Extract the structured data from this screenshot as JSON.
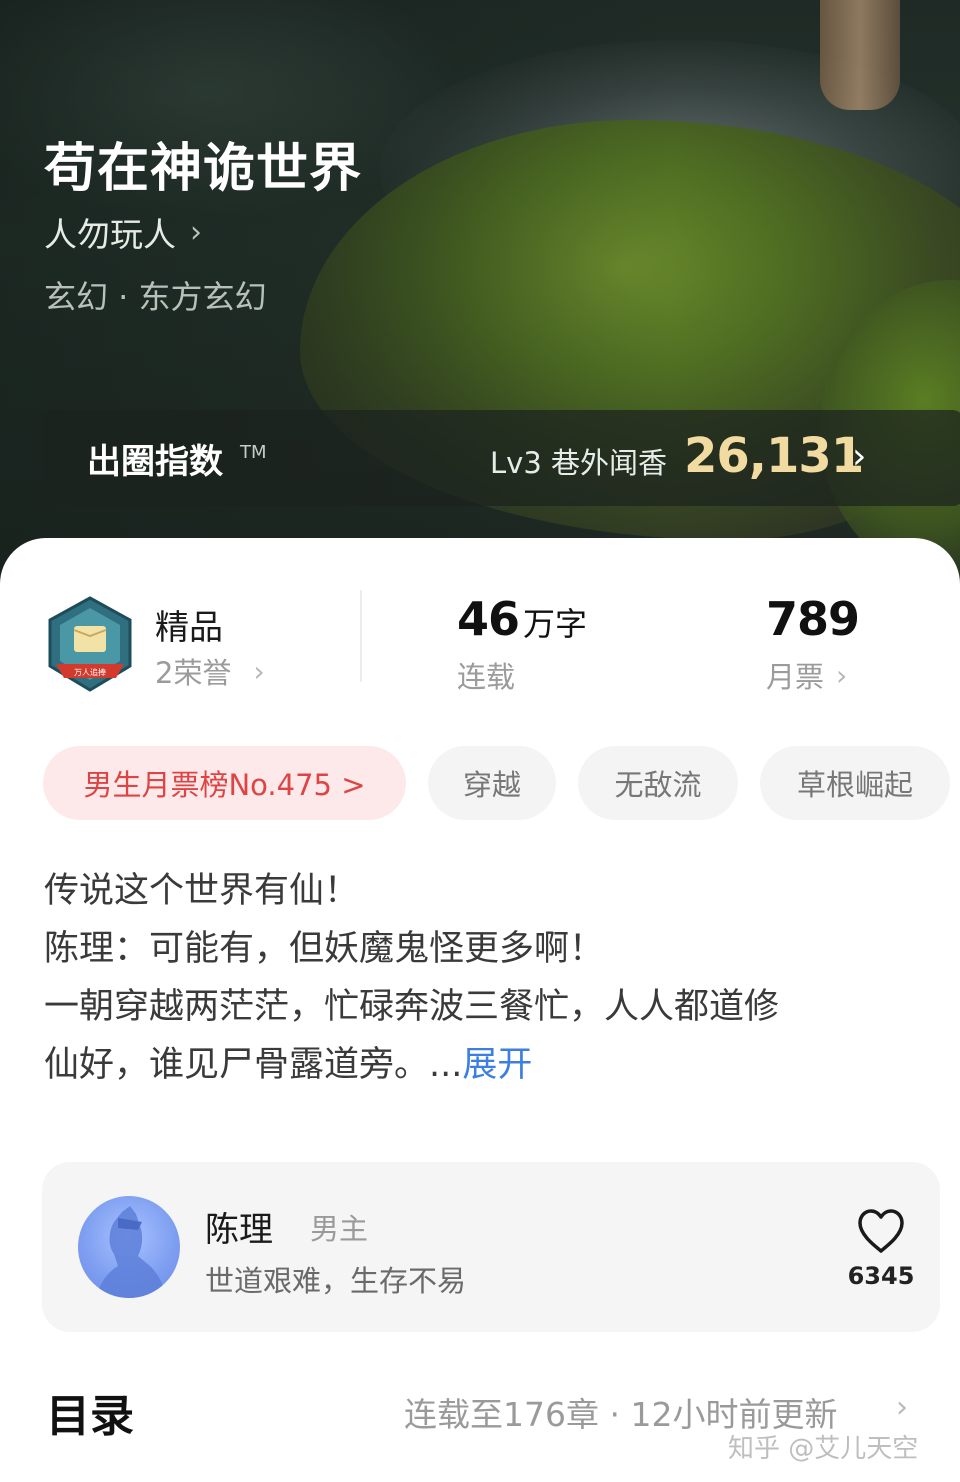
{
  "book": {
    "title": "苟在神诡世界",
    "author": "人勿玩人",
    "author_chevron": "›",
    "genre": "玄幻 · 东方玄幻"
  },
  "index": {
    "label": "出圈指数",
    "tm": "TM",
    "level": "Lv3 巷外闻香",
    "value": "26,131",
    "chevron": "›"
  },
  "stats": {
    "quality_label": "精品",
    "honors": "2荣誉",
    "badge_text": "万人追捧",
    "word_count_num": "46",
    "word_count_unit": "万字",
    "status": "连载",
    "monthly_votes": "789",
    "monthly_votes_label": "月票",
    "chevron": "›"
  },
  "tags": {
    "rank": "男生月票榜No.475 >",
    "items": [
      "穿越",
      "无敌流",
      "草根崛起"
    ]
  },
  "synopsis": {
    "lines": [
      "传说这个世界有仙！",
      "陈理：可能有，但妖魔鬼怪更多啊！",
      "一朝穿越两茫茫，忙碌奔波三餐忙，人人都道修",
      "仙好，谁见尸骨露道旁。..."
    ],
    "expand": "展开"
  },
  "character": {
    "name": "陈理",
    "role": "男主",
    "quote": "世道艰难，生存不易",
    "likes": "6345",
    "heart_icon": "heart-outline"
  },
  "toc": {
    "title": "目录",
    "info": "连载至176章 · 12小时前更新",
    "chevron": "›"
  },
  "watermark": "知乎 @艾儿天空",
  "colors": {
    "rank_tag_bg": "#fde9e9",
    "rank_tag_text": "#de4444",
    "expand_link": "#3d7fe0",
    "index_value": "#f2dba0"
  }
}
